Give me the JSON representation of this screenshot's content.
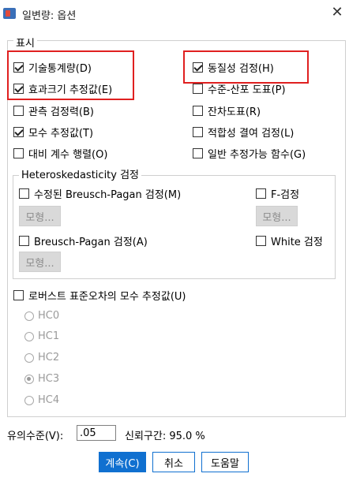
{
  "window": {
    "title": "일변량: 옵션",
    "close_symbol": "✕"
  },
  "display": {
    "legend": "표시",
    "left": [
      {
        "label": "기술통계량(D)",
        "checked": true
      },
      {
        "label": "효과크기 추정값(E)",
        "checked": true
      },
      {
        "label": "관측 검정력(B)",
        "checked": false
      },
      {
        "label": "모수 추정값(T)",
        "checked": true
      },
      {
        "label": "대비 계수 행렬(O)",
        "checked": false
      }
    ],
    "right": [
      {
        "label": "동질성 검정(H)",
        "checked": true
      },
      {
        "label": "수준-산포 도표(P)",
        "checked": false
      },
      {
        "label": "잔차도표(R)",
        "checked": false
      },
      {
        "label": "적합성 결여 검정(L)",
        "checked": false
      },
      {
        "label": "일반 추정가능 함수(G)",
        "checked": false
      }
    ]
  },
  "hetero": {
    "legend": "Heteroskedasticity 검정",
    "modified_bp": "수정된 Breusch-Pagan 검정(M)",
    "f_test": "F-검정",
    "bp": "Breusch-Pagan 검정(A)",
    "white": "White 검정",
    "model_button": "모형..."
  },
  "robust": {
    "label": "로버스트 표준오차의 모수 추정값(U)",
    "options": [
      "HC0",
      "HC1",
      "HC2",
      "HC3",
      "HC4"
    ],
    "selected": "HC3"
  },
  "bottom": {
    "sig_label": "유의수준(V):",
    "sig_value": ".05",
    "ci_label": "신뢰구간: 95.0 %"
  },
  "buttons": {
    "continue": "계속(C)",
    "cancel": "취소",
    "help": "도움말"
  },
  "colors": {
    "primary": "#1070d0",
    "highlight": "#e02020"
  }
}
